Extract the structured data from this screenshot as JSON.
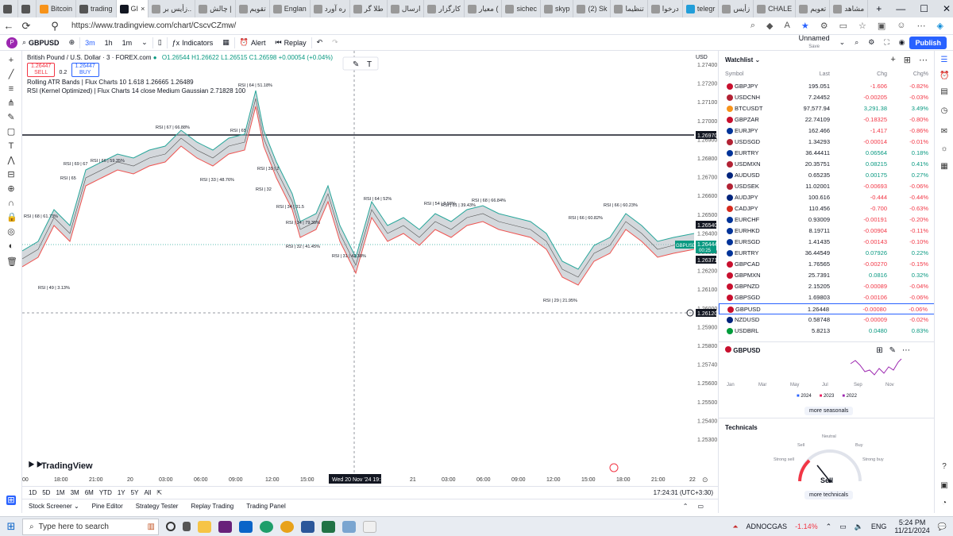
{
  "browser": {
    "tabs": [
      {
        "label": "",
        "color": "#555"
      },
      {
        "label": "",
        "color": "#555"
      },
      {
        "label": "Bitcoin",
        "color": "#f7931a"
      },
      {
        "label": "trading",
        "color": "#555"
      },
      {
        "label": "GI",
        "color": "#131722"
      },
      {
        "label": "زأيس بر..",
        "color": "#999"
      },
      {
        "label": "چالش |",
        "color": "#999"
      },
      {
        "label": "تقویم",
        "color": "#999"
      },
      {
        "label": "Englan",
        "color": "#999"
      },
      {
        "label": "ره آورد",
        "color": "#999"
      },
      {
        "label": "طلا گر",
        "color": "#999"
      },
      {
        "label": "ارسال",
        "color": "#999"
      },
      {
        "label": "کارگزار",
        "color": "#999"
      },
      {
        "label": "معیار (",
        "color": "#999"
      },
      {
        "label": "sichec",
        "color": "#999"
      },
      {
        "label": "skyp",
        "color": "#999"
      },
      {
        "label": "(2) Sk",
        "color": "#999"
      },
      {
        "label": "تنظیما",
        "color": "#999"
      },
      {
        "label": "درخوا",
        "color": "#999"
      },
      {
        "label": "telegr",
        "color": "#229ed9"
      },
      {
        "label": "زأيس",
        "color": "#999"
      },
      {
        "label": "CHALE",
        "color": "#999"
      },
      {
        "label": "تعویم",
        "color": "#999"
      },
      {
        "label": "مشاهد",
        "color": "#999"
      }
    ],
    "url": "https://www.tradingview.com/chart/CscvCZmw/"
  },
  "toolbar": {
    "symbol": "GBPUSD",
    "intervals": [
      "3m",
      "1h",
      "1m"
    ],
    "indicators": "Indicators",
    "alert": "Alert",
    "replay": "Replay",
    "layout_name": "Unnamed",
    "layout_sub": "Save",
    "publish": "Publish"
  },
  "legend": {
    "title": "British Pound / U.S. Dollar · 3 · FOREX.com",
    "ohlc": "O1.26544 H1.26622 L1.26515 C1.26598 +0.00054 (+0.04%)",
    "sell_price": "1.26447",
    "sell_label": "SELL",
    "spread": "0.2",
    "buy_price": "1.26447",
    "buy_label": "BUY",
    "ind1": "Rolling ATR Bands | Flux Charts 10 1.618 1.26665 1.26489",
    "ind2": "RSI (Kernel Optimized) | Flux Charts 14 close Medium Gaussian 2.71828 100"
  },
  "price_axis": {
    "ccy": "USD",
    "labels": [
      "1.27400",
      "1.27200",
      "1.27100",
      "1.27000",
      "1.26900",
      "1.26800",
      "1.26700",
      "1.26600",
      "1.26500",
      "1.26400",
      "1.26300",
      "1.26200",
      "1.26100",
      "1.26000",
      "1.25900",
      "1.25800",
      "1.25740",
      "1.25600",
      "1.25500",
      "1.25400",
      "1.25300"
    ],
    "tag_hline": "1.26970",
    "tag_high": "1.26540",
    "tag_symbol": "GBPUSD",
    "tag_current": "1.26444",
    "tag_current_sub": "00:25",
    "tag_low": "1.26371",
    "tag_cursor": "1.26120"
  },
  "rsi_labels": [
    "RSI | 64 | 51.18%",
    "RSI | 67 | 66.88%",
    "RSI | 65",
    "RSI | 66 | 59.35%",
    "RSI | 69 | 67",
    "RSI | 65",
    "RSI | 33 | 48.76%",
    "RSI | 39 | 2",
    "RSI | 32",
    "RSI | 34 | 31.5",
    "RSI | 34 | 79.35%",
    "RSI | 32 | 41.45%",
    "RSI | 31 | 42.38%",
    "RSI | 64 | 52%",
    "RSI | 54 | 8.58%",
    "RSI | 61 | 39.43%",
    "RSI | 68 | 66.84%",
    "RSI | 66 | 60.23%",
    "RSI | 66 | 60.82%",
    "RSI | 68 | 61.73%",
    "RSI | 49 | 3.13%",
    "RSI | 29 | 21.95%"
  ],
  "time_axis": {
    "labels": [
      "00",
      "18:00",
      "21:00",
      "20",
      "03:00",
      "06:00",
      "09:00",
      "12:00",
      "15:00",
      "21",
      "03:00",
      "06:00",
      "09:00",
      "12:00",
      "15:00",
      "18:00",
      "21:00",
      "22"
    ],
    "cursor": "Wed 20 Nov '24   19:15"
  },
  "ranges": [
    "1D",
    "5D",
    "1M",
    "3M",
    "6M",
    "YTD",
    "1Y",
    "5Y",
    "All"
  ],
  "clock": "17:24:31 (UTC+3:30)",
  "bottom_tabs": [
    "Stock Screener",
    "Pine Editor",
    "Strategy Tester",
    "Replay Trading",
    "Trading Panel"
  ],
  "watermark": "TradingView",
  "watchlist": {
    "title": "Watchlist",
    "cols": [
      "Symbol",
      "Last",
      "Chg",
      "Chg%"
    ],
    "rows": [
      {
        "sym": "GBPJPY",
        "last": "195.051",
        "chg": "-1.606",
        "chgp": "-0.82%",
        "dir": "down",
        "flag": "#c8102e"
      },
      {
        "sym": "USDCNH",
        "last": "7.24452",
        "chg": "-0.00205",
        "chgp": "-0.03%",
        "dir": "down",
        "flag": "#b22234"
      },
      {
        "sym": "BTCUSDT",
        "last": "97,577.94",
        "chg": "3,291.38",
        "chgp": "3.49%",
        "dir": "up",
        "flag": "#f7931a"
      },
      {
        "sym": "GBPZAR",
        "last": "22.74109",
        "chg": "-0.18325",
        "chgp": "-0.80%",
        "dir": "down",
        "flag": "#c8102e"
      },
      {
        "sym": "EURJPY",
        "last": "162.466",
        "chg": "-1.417",
        "chgp": "-0.86%",
        "dir": "down",
        "flag": "#003399"
      },
      {
        "sym": "USDSGD",
        "last": "1.34293",
        "chg": "-0.00014",
        "chgp": "-0.01%",
        "dir": "down",
        "flag": "#b22234"
      },
      {
        "sym": "EURTRY",
        "last": "36.44411",
        "chg": "0.06564",
        "chgp": "0.18%",
        "dir": "up",
        "flag": "#003399"
      },
      {
        "sym": "USDMXN",
        "last": "20.35751",
        "chg": "0.08215",
        "chgp": "0.41%",
        "dir": "up",
        "flag": "#b22234"
      },
      {
        "sym": "AUDUSD",
        "last": "0.65235",
        "chg": "0.00175",
        "chgp": "0.27%",
        "dir": "up",
        "flag": "#00247d"
      },
      {
        "sym": "USDSEK",
        "last": "11.02001",
        "chg": "-0.00693",
        "chgp": "-0.06%",
        "dir": "down",
        "flag": "#b22234"
      },
      {
        "sym": "AUDJPY",
        "last": "100.616",
        "chg": "-0.444",
        "chgp": "-0.44%",
        "dir": "down",
        "flag": "#00247d"
      },
      {
        "sym": "CADJPY",
        "last": "110.456",
        "chg": "-0.700",
        "chgp": "-0.63%",
        "dir": "down",
        "flag": "#d52b1e"
      },
      {
        "sym": "EURCHF",
        "last": "0.93009",
        "chg": "-0.00191",
        "chgp": "-0.20%",
        "dir": "down",
        "flag": "#003399"
      },
      {
        "sym": "EURHKD",
        "last": "8.19711",
        "chg": "-0.00904",
        "chgp": "-0.11%",
        "dir": "down",
        "flag": "#003399"
      },
      {
        "sym": "EURSGD",
        "last": "1.41435",
        "chg": "-0.00143",
        "chgp": "-0.10%",
        "dir": "down",
        "flag": "#003399"
      },
      {
        "sym": "EURTRY",
        "last": "36.44549",
        "chg": "0.07926",
        "chgp": "0.22%",
        "dir": "up",
        "flag": "#003399"
      },
      {
        "sym": "GBPCAD",
        "last": "1.76565",
        "chg": "-0.00270",
        "chgp": "-0.15%",
        "dir": "down",
        "flag": "#c8102e"
      },
      {
        "sym": "GBPMXN",
        "last": "25.7391",
        "chg": "0.0816",
        "chgp": "0.32%",
        "dir": "up",
        "flag": "#c8102e"
      },
      {
        "sym": "GBPNZD",
        "last": "2.15205",
        "chg": "-0.00089",
        "chgp": "-0.04%",
        "dir": "down",
        "flag": "#c8102e"
      },
      {
        "sym": "GBPSGD",
        "last": "1.69803",
        "chg": "-0.00106",
        "chgp": "-0.06%",
        "dir": "down",
        "flag": "#c8102e"
      },
      {
        "sym": "GBPUSD",
        "last": "1.26448",
        "chg": "-0.00080",
        "chgp": "-0.06%",
        "dir": "down",
        "flag": "#c8102e",
        "selected": true
      },
      {
        "sym": "NZDUSD",
        "last": "0.58748",
        "chg": "-0.00009",
        "chgp": "-0.02%",
        "dir": "down",
        "flag": "#00247d"
      },
      {
        "sym": "USDBRL",
        "last": "5.8213",
        "chg": "0.0480",
        "chgp": "0.83%",
        "dir": "up",
        "flag": "#009c3b"
      }
    ]
  },
  "details": {
    "symbol": "GBPUSD",
    "months": [
      "Jan",
      "Mar",
      "May",
      "Jul",
      "Sep",
      "Nov"
    ],
    "years": [
      "2024",
      "2023",
      "2022"
    ],
    "more_seasonals": "more seasonals",
    "technicals_title": "Technicals",
    "gauge_neutral": "Neutral",
    "gauge_sell": "Sell",
    "gauge_buy": "Buy",
    "gauge_strong_sell": "Strong sell",
    "gauge_strong_buy": "Strong buy",
    "verdict": "Sell",
    "more_technicals": "more technicals"
  },
  "taskbar": {
    "search_placeholder": "Type here to search",
    "ticker": "ADNOCGAS",
    "ticker_change": "-1.14%",
    "lang": "ENG",
    "time": "5:24 PM",
    "date": "11/21/2024"
  },
  "colors": {
    "accent": "#2962ff",
    "up": "#089981",
    "down": "#f23645"
  }
}
